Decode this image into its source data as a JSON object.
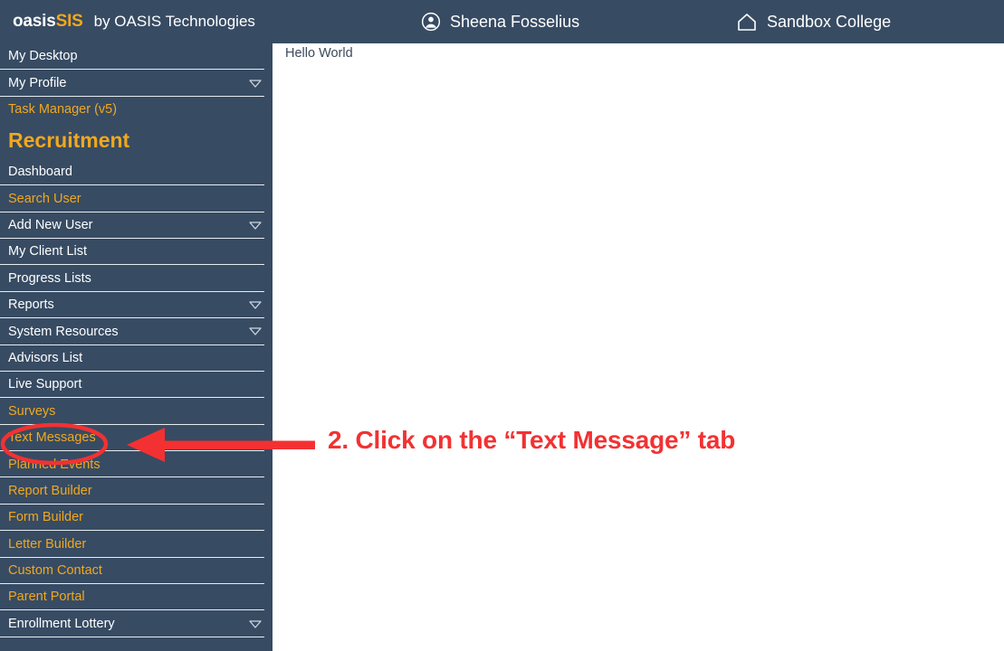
{
  "header": {
    "brand_primary": "oasis",
    "brand_accent": "SIS",
    "byline": "by OASIS Technologies",
    "user_name": "Sheena Fosselius",
    "user_icon": "user-circle-icon",
    "org_name": "Sandbox College",
    "org_icon": "home-icon",
    "background_color": "#374b63"
  },
  "sidebar": {
    "background_color": "#374b63",
    "text_color_white": "#ffffff",
    "text_color_gold": "#f0a81e",
    "separator_color": "#e9edf2",
    "section_heading": "Recruitment",
    "items": [
      {
        "label": "My Desktop",
        "color": "white",
        "chevron": false
      },
      {
        "label": "My Profile",
        "color": "white",
        "chevron": true
      },
      {
        "label": "Task Manager (v5)",
        "color": "gold",
        "chevron": false
      },
      {
        "label": "Dashboard",
        "color": "white",
        "chevron": false
      },
      {
        "label": "Search User",
        "color": "gold",
        "chevron": false
      },
      {
        "label": "Add New User",
        "color": "white",
        "chevron": true
      },
      {
        "label": "My Client List",
        "color": "white",
        "chevron": false
      },
      {
        "label": "Progress Lists",
        "color": "white",
        "chevron": false
      },
      {
        "label": "Reports",
        "color": "white",
        "chevron": true
      },
      {
        "label": "System Resources",
        "color": "white",
        "chevron": true
      },
      {
        "label": "Advisors List",
        "color": "white",
        "chevron": false
      },
      {
        "label": "Live Support",
        "color": "white",
        "chevron": false
      },
      {
        "label": "Surveys",
        "color": "gold",
        "chevron": false
      },
      {
        "label": "Text Messages",
        "color": "gold",
        "chevron": false
      },
      {
        "label": "Planned Events",
        "color": "gold",
        "chevron": false
      },
      {
        "label": "Report Builder",
        "color": "gold",
        "chevron": false
      },
      {
        "label": "Form Builder",
        "color": "gold",
        "chevron": false
      },
      {
        "label": "Letter Builder",
        "color": "gold",
        "chevron": false
      },
      {
        "label": "Custom Contact",
        "color": "gold",
        "chevron": false
      },
      {
        "label": "Parent Portal",
        "color": "gold",
        "chevron": false
      },
      {
        "label": "Enrollment Lottery",
        "color": "white",
        "chevron": true
      }
    ]
  },
  "main": {
    "body_text": "Hello World",
    "background_color": "#ffffff"
  },
  "annotation": {
    "text": "2. Click on the “Text Message” tab",
    "color": "#f33132",
    "highlight_target": "Text Messages",
    "ellipse_shape": "red-ellipse-around-text-messages",
    "arrow_direction": "left"
  }
}
